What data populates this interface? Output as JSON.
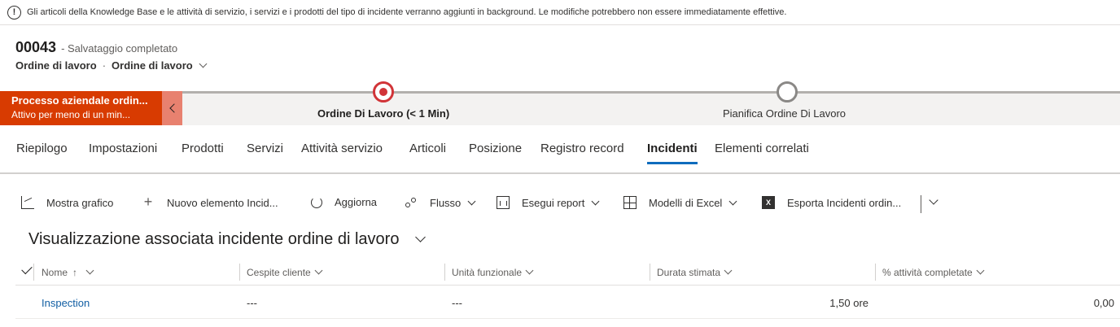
{
  "notification": {
    "icon": "info-icon",
    "text": "Gli articoli della Knowledge Base e le attività di servizio, i servizi e i prodotti del tipo di incidente verranno aggiunti in background. Le modifiche potrebbero non essere immediatamente effettive."
  },
  "header": {
    "record_id": "00043",
    "save_status": "- Salvataggio completato",
    "entity": "Ordine di lavoro",
    "separator": "·",
    "form": "Ordine di lavoro"
  },
  "process": {
    "active_title": "Processo aziendale ordin...",
    "active_subtitle": "Attivo per meno di un min...",
    "stages": [
      {
        "label": "Ordine Di Lavoro  (< 1 Min)",
        "active": true
      },
      {
        "label": "Pianifica Ordine Di Lavoro",
        "active": false
      }
    ],
    "colors": {
      "active": "#d83b01",
      "collapse": "#e8816f",
      "stage_ring": "#d13438"
    }
  },
  "tabs": [
    {
      "label": "Riepilogo"
    },
    {
      "label": "Impostazioni"
    },
    {
      "label": "Prodotti"
    },
    {
      "label": "Servizi"
    },
    {
      "label": "Attività servizio"
    },
    {
      "label": "Articoli"
    },
    {
      "label": "Posizione"
    },
    {
      "label": "Registro record"
    },
    {
      "label": "Incidenti",
      "selected": true
    },
    {
      "label": "Elementi correlati"
    }
  ],
  "commands": [
    {
      "label": "Mostra grafico",
      "icon": "chart-icon"
    },
    {
      "label": "Nuovo elemento Incid...",
      "icon": "plus-icon"
    },
    {
      "label": "Aggiorna",
      "icon": "refresh-icon"
    },
    {
      "label": "Flusso",
      "icon": "flow-icon",
      "dropdown": true
    },
    {
      "label": "Esegui report",
      "icon": "report-icon",
      "dropdown": true
    },
    {
      "label": "Modelli di Excel",
      "icon": "excel-template-icon",
      "dropdown": true
    },
    {
      "label": "Esporta Incidenti ordin...",
      "icon": "excel-export-icon"
    }
  ],
  "view": {
    "title": "Visualizzazione associata incidente ordine di lavoro"
  },
  "grid": {
    "columns": [
      {
        "label": "Nome",
        "sort": "↑"
      },
      {
        "label": "Cespite cliente"
      },
      {
        "label": "Unità funzionale"
      },
      {
        "label": "Durata stimata"
      },
      {
        "label": "% attività completate"
      }
    ],
    "rows": [
      {
        "name": "Inspection",
        "asset": "---",
        "unit": "---",
        "duration": "1,50 ore",
        "percent": "0,00"
      }
    ]
  },
  "accent": "#0f6cbd"
}
